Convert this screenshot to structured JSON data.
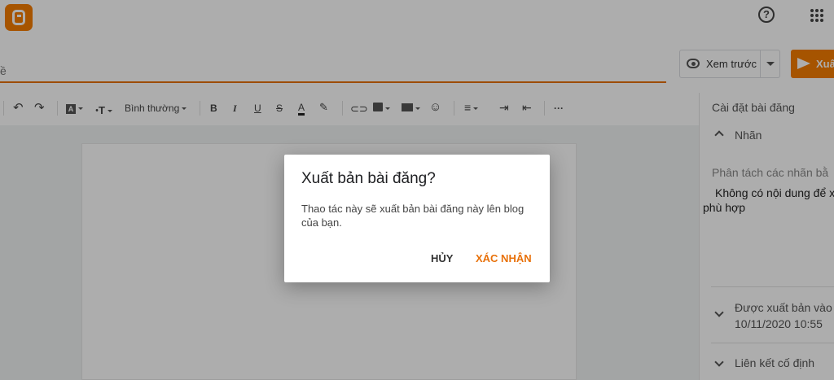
{
  "header": {
    "help_icon_glyph": "?",
    "accent_color": "#f57d00"
  },
  "title_bar": {
    "title_placeholder": "ề"
  },
  "actions": {
    "preview_label": "Xem trước",
    "publish_label": "Xuấ"
  },
  "toolbar": {
    "paragraph_style": "Bình thường",
    "bold": "B",
    "italic": "I",
    "underline": "U",
    "strike": "S",
    "text_color": "A",
    "more": "···"
  },
  "sidebar": {
    "title": "Cài đặt bài đăng",
    "labels_heading": "Nhãn",
    "labels_placeholder": "Phân tách các nhãn bằ",
    "labels_empty_line1": "Không có nội dung để xu",
    "labels_empty_line2": "phù hợp",
    "published_heading": "Được xuất bản vào",
    "published_date": "10/11/2020 10:55",
    "permalink_heading": "Liên kết cố định"
  },
  "dialog": {
    "title": "Xuất bản bài đăng?",
    "body": "Thao tác này sẽ xuất bản bài đăng này lên blog của bạn.",
    "cancel_label": "HỦY",
    "confirm_label": "XÁC NHẬN",
    "confirm_color": "#e8710a"
  }
}
